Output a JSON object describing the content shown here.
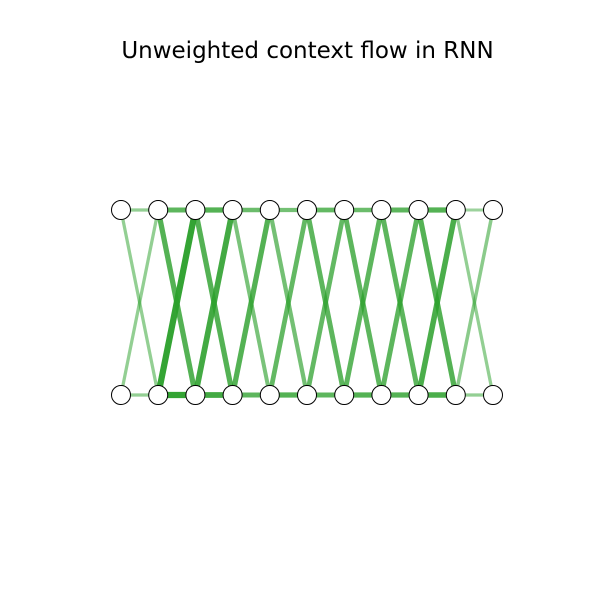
{
  "title": "Unweighted context flow in RNN",
  "colors": {
    "edge": "#2ca02c",
    "node_fill": "#ffffff",
    "node_stroke": "#000000"
  },
  "diagram": {
    "type": "bipartite-flow",
    "top_node_count": 11,
    "bottom_node_count": 11,
    "edges": [
      {
        "from": "top-0",
        "to": "top-1",
        "strength": 0.35
      },
      {
        "from": "top-1",
        "to": "top-2",
        "strength": 0.7
      },
      {
        "from": "top-2",
        "to": "top-3",
        "strength": 0.75
      },
      {
        "from": "top-3",
        "to": "top-4",
        "strength": 0.6
      },
      {
        "from": "top-4",
        "to": "top-5",
        "strength": 0.55
      },
      {
        "from": "top-5",
        "to": "top-6",
        "strength": 0.65
      },
      {
        "from": "top-6",
        "to": "top-7",
        "strength": 0.6
      },
      {
        "from": "top-7",
        "to": "top-8",
        "strength": 0.7
      },
      {
        "from": "top-8",
        "to": "top-9",
        "strength": 0.75
      },
      {
        "from": "top-9",
        "to": "top-10",
        "strength": 0.3
      },
      {
        "from": "bottom-0",
        "to": "bottom-1",
        "strength": 0.35
      },
      {
        "from": "bottom-1",
        "to": "bottom-2",
        "strength": 0.95
      },
      {
        "from": "bottom-2",
        "to": "bottom-3",
        "strength": 0.85
      },
      {
        "from": "bottom-3",
        "to": "bottom-4",
        "strength": 0.7
      },
      {
        "from": "bottom-4",
        "to": "bottom-5",
        "strength": 0.75
      },
      {
        "from": "bottom-5",
        "to": "bottom-6",
        "strength": 0.7
      },
      {
        "from": "bottom-6",
        "to": "bottom-7",
        "strength": 0.75
      },
      {
        "from": "bottom-7",
        "to": "bottom-8",
        "strength": 0.75
      },
      {
        "from": "bottom-8",
        "to": "bottom-9",
        "strength": 0.8
      },
      {
        "from": "bottom-9",
        "to": "bottom-10",
        "strength": 0.35
      },
      {
        "from": "top-0",
        "to": "bottom-1",
        "strength": 0.35
      },
      {
        "from": "top-1",
        "to": "bottom-0",
        "strength": 0.35
      },
      {
        "from": "top-1",
        "to": "bottom-2",
        "strength": 0.75
      },
      {
        "from": "top-2",
        "to": "bottom-1",
        "strength": 0.95
      },
      {
        "from": "top-2",
        "to": "bottom-3",
        "strength": 0.75
      },
      {
        "from": "top-3",
        "to": "bottom-2",
        "strength": 0.85
      },
      {
        "from": "top-3",
        "to": "bottom-4",
        "strength": 0.5
      },
      {
        "from": "top-4",
        "to": "bottom-3",
        "strength": 0.75
      },
      {
        "from": "top-4",
        "to": "bottom-5",
        "strength": 0.55
      },
      {
        "from": "top-5",
        "to": "bottom-4",
        "strength": 0.65
      },
      {
        "from": "top-5",
        "to": "bottom-6",
        "strength": 0.7
      },
      {
        "from": "top-6",
        "to": "bottom-5",
        "strength": 0.65
      },
      {
        "from": "top-6",
        "to": "bottom-7",
        "strength": 0.7
      },
      {
        "from": "top-7",
        "to": "bottom-6",
        "strength": 0.7
      },
      {
        "from": "top-7",
        "to": "bottom-8",
        "strength": 0.7
      },
      {
        "from": "top-8",
        "to": "bottom-7",
        "strength": 0.7
      },
      {
        "from": "top-8",
        "to": "bottom-9",
        "strength": 0.75
      },
      {
        "from": "top-9",
        "to": "bottom-8",
        "strength": 0.8
      },
      {
        "from": "top-9",
        "to": "bottom-10",
        "strength": 0.35
      },
      {
        "from": "top-10",
        "to": "bottom-9",
        "strength": 0.4
      }
    ]
  }
}
